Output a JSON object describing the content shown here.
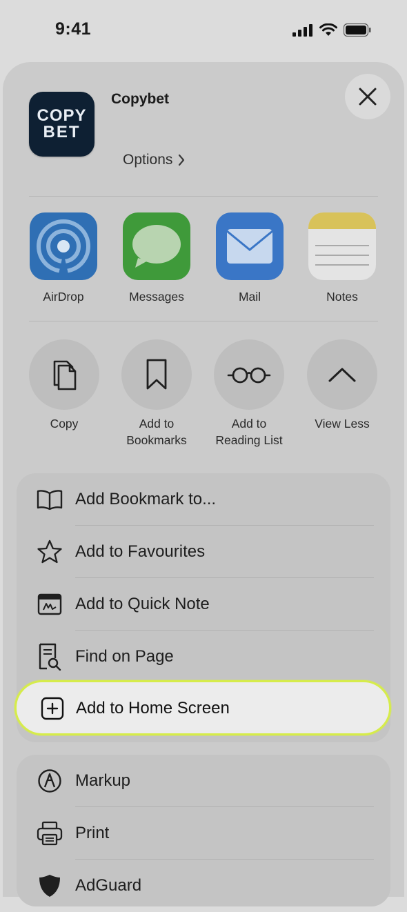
{
  "status": {
    "time": "9:41"
  },
  "header": {
    "app_title": "Copybet",
    "icon_line1": "COPY",
    "icon_line2": "BET",
    "options_label": "Options"
  },
  "share_targets": [
    {
      "label": "AirDrop",
      "icon": "airdrop-icon"
    },
    {
      "label": "Messages",
      "icon": "messages-icon"
    },
    {
      "label": "Mail",
      "icon": "mail-icon"
    },
    {
      "label": "Notes",
      "icon": "notes-icon"
    }
  ],
  "actions": [
    {
      "label_l1": "Copy",
      "label_l2": "",
      "icon": "copy-icon"
    },
    {
      "label_l1": "Add to",
      "label_l2": "Bookmarks",
      "icon": "bookmark-icon"
    },
    {
      "label_l1": "Add to",
      "label_l2": "Reading List",
      "icon": "glasses-icon"
    },
    {
      "label_l1": "View Less",
      "label_l2": "",
      "icon": "chevron-up-icon"
    }
  ],
  "menu_group1": [
    {
      "label": "Add Bookmark to...",
      "icon": "book-icon"
    },
    {
      "label": "Add to Favourites",
      "icon": "star-icon"
    },
    {
      "label": "Add to Quick Note",
      "icon": "quick-note-icon"
    },
    {
      "label": "Find on Page",
      "icon": "find-on-page-icon"
    }
  ],
  "highlighted_item": {
    "label": "Add to Home Screen",
    "icon": "plus-square-icon",
    "outline_color": "#d6ec4a"
  },
  "menu_group2": [
    {
      "label": "Markup",
      "icon": "markup-icon"
    },
    {
      "label": "Print",
      "icon": "printer-icon"
    },
    {
      "label": "AdGuard",
      "icon": "adguard-icon"
    }
  ]
}
